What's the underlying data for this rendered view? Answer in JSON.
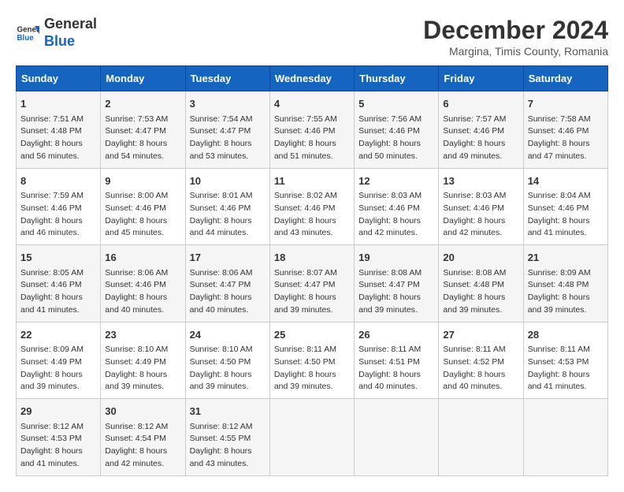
{
  "logo": {
    "line1": "General",
    "line2": "Blue"
  },
  "title": "December 2024",
  "subtitle": "Margina, Timis County, Romania",
  "days_of_week": [
    "Sunday",
    "Monday",
    "Tuesday",
    "Wednesday",
    "Thursday",
    "Friday",
    "Saturday"
  ],
  "weeks": [
    [
      {
        "day": 1,
        "info": "Sunrise: 7:51 AM\nSunset: 4:48 PM\nDaylight: 8 hours\nand 56 minutes."
      },
      {
        "day": 2,
        "info": "Sunrise: 7:53 AM\nSunset: 4:47 PM\nDaylight: 8 hours\nand 54 minutes."
      },
      {
        "day": 3,
        "info": "Sunrise: 7:54 AM\nSunset: 4:47 PM\nDaylight: 8 hours\nand 53 minutes."
      },
      {
        "day": 4,
        "info": "Sunrise: 7:55 AM\nSunset: 4:46 PM\nDaylight: 8 hours\nand 51 minutes."
      },
      {
        "day": 5,
        "info": "Sunrise: 7:56 AM\nSunset: 4:46 PM\nDaylight: 8 hours\nand 50 minutes."
      },
      {
        "day": 6,
        "info": "Sunrise: 7:57 AM\nSunset: 4:46 PM\nDaylight: 8 hours\nand 49 minutes."
      },
      {
        "day": 7,
        "info": "Sunrise: 7:58 AM\nSunset: 4:46 PM\nDaylight: 8 hours\nand 47 minutes."
      }
    ],
    [
      {
        "day": 8,
        "info": "Sunrise: 7:59 AM\nSunset: 4:46 PM\nDaylight: 8 hours\nand 46 minutes."
      },
      {
        "day": 9,
        "info": "Sunrise: 8:00 AM\nSunset: 4:46 PM\nDaylight: 8 hours\nand 45 minutes."
      },
      {
        "day": 10,
        "info": "Sunrise: 8:01 AM\nSunset: 4:46 PM\nDaylight: 8 hours\nand 44 minutes."
      },
      {
        "day": 11,
        "info": "Sunrise: 8:02 AM\nSunset: 4:46 PM\nDaylight: 8 hours\nand 43 minutes."
      },
      {
        "day": 12,
        "info": "Sunrise: 8:03 AM\nSunset: 4:46 PM\nDaylight: 8 hours\nand 42 minutes."
      },
      {
        "day": 13,
        "info": "Sunrise: 8:03 AM\nSunset: 4:46 PM\nDaylight: 8 hours\nand 42 minutes."
      },
      {
        "day": 14,
        "info": "Sunrise: 8:04 AM\nSunset: 4:46 PM\nDaylight: 8 hours\nand 41 minutes."
      }
    ],
    [
      {
        "day": 15,
        "info": "Sunrise: 8:05 AM\nSunset: 4:46 PM\nDaylight: 8 hours\nand 41 minutes."
      },
      {
        "day": 16,
        "info": "Sunrise: 8:06 AM\nSunset: 4:46 PM\nDaylight: 8 hours\nand 40 minutes."
      },
      {
        "day": 17,
        "info": "Sunrise: 8:06 AM\nSunset: 4:47 PM\nDaylight: 8 hours\nand 40 minutes."
      },
      {
        "day": 18,
        "info": "Sunrise: 8:07 AM\nSunset: 4:47 PM\nDaylight: 8 hours\nand 39 minutes."
      },
      {
        "day": 19,
        "info": "Sunrise: 8:08 AM\nSunset: 4:47 PM\nDaylight: 8 hours\nand 39 minutes."
      },
      {
        "day": 20,
        "info": "Sunrise: 8:08 AM\nSunset: 4:48 PM\nDaylight: 8 hours\nand 39 minutes."
      },
      {
        "day": 21,
        "info": "Sunrise: 8:09 AM\nSunset: 4:48 PM\nDaylight: 8 hours\nand 39 minutes."
      }
    ],
    [
      {
        "day": 22,
        "info": "Sunrise: 8:09 AM\nSunset: 4:49 PM\nDaylight: 8 hours\nand 39 minutes."
      },
      {
        "day": 23,
        "info": "Sunrise: 8:10 AM\nSunset: 4:49 PM\nDaylight: 8 hours\nand 39 minutes."
      },
      {
        "day": 24,
        "info": "Sunrise: 8:10 AM\nSunset: 4:50 PM\nDaylight: 8 hours\nand 39 minutes."
      },
      {
        "day": 25,
        "info": "Sunrise: 8:11 AM\nSunset: 4:50 PM\nDaylight: 8 hours\nand 39 minutes."
      },
      {
        "day": 26,
        "info": "Sunrise: 8:11 AM\nSunset: 4:51 PM\nDaylight: 8 hours\nand 40 minutes."
      },
      {
        "day": 27,
        "info": "Sunrise: 8:11 AM\nSunset: 4:52 PM\nDaylight: 8 hours\nand 40 minutes."
      },
      {
        "day": 28,
        "info": "Sunrise: 8:11 AM\nSunset: 4:53 PM\nDaylight: 8 hours\nand 41 minutes."
      }
    ],
    [
      {
        "day": 29,
        "info": "Sunrise: 8:12 AM\nSunset: 4:53 PM\nDaylight: 8 hours\nand 41 minutes."
      },
      {
        "day": 30,
        "info": "Sunrise: 8:12 AM\nSunset: 4:54 PM\nDaylight: 8 hours\nand 42 minutes."
      },
      {
        "day": 31,
        "info": "Sunrise: 8:12 AM\nSunset: 4:55 PM\nDaylight: 8 hours\nand 43 minutes."
      },
      null,
      null,
      null,
      null
    ]
  ]
}
